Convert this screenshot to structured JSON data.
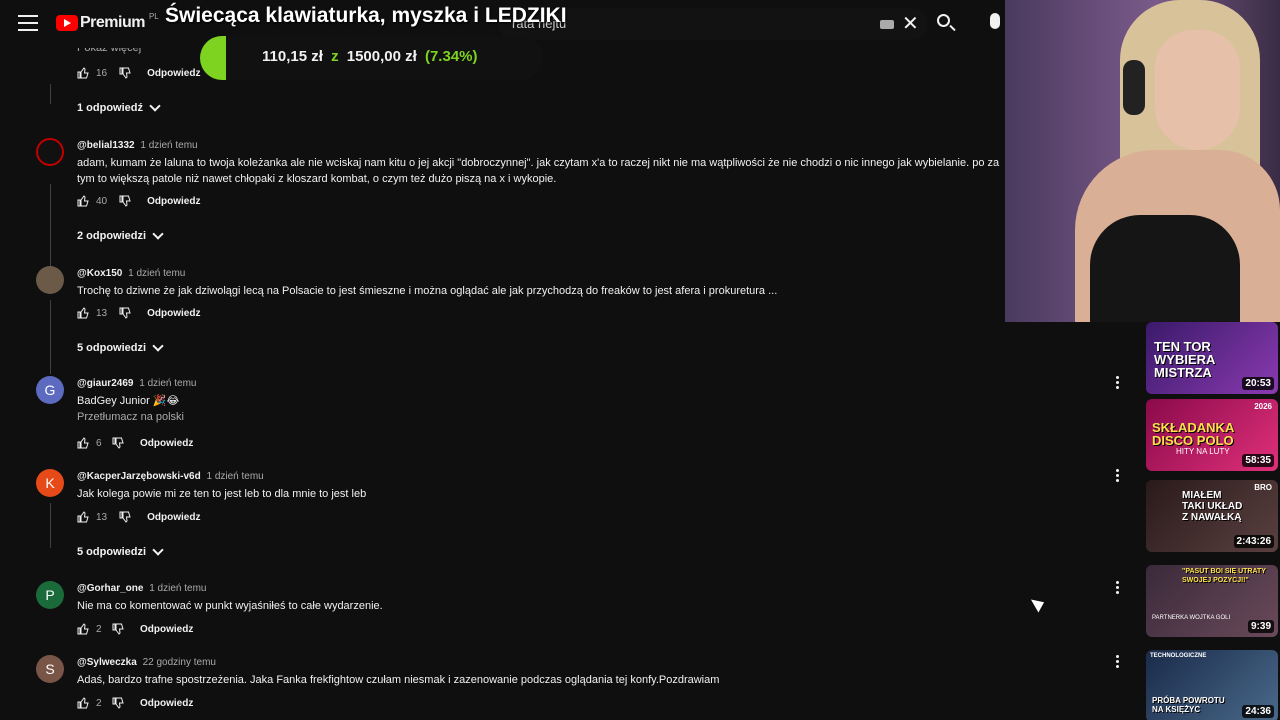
{
  "header": {
    "logo_text": "Premium",
    "logo_region": "PL",
    "search_text": "rata nejtu",
    "icons": [
      "menu-icon",
      "keyboard-icon",
      "close-icon",
      "search-icon",
      "mic-icon"
    ]
  },
  "stream": {
    "title": "Świecąca klawiaturka, myszka i LEDZIKI",
    "donation": {
      "current": "110,15 zł",
      "separator": "z",
      "goal": "1500,00 zł",
      "percent": "(7.34%)",
      "progress": 0.0734,
      "color": "#7ed321"
    }
  },
  "show_more": "Pokaż więcej",
  "comments": [
    {
      "id": "top",
      "likes": "16",
      "reply_label": "Odpowiedz",
      "replies_toggle": "1 odpowiedź"
    },
    {
      "id": "belial",
      "author": "@belial1332",
      "time": "1 dzień temu",
      "text": "adam, kumam że laluna to twoja koleżanka ale nie wciskaj nam kitu o jej akcji \"dobroczynnej\". jak czytam x'a to raczej nikt nie ma wątpliwości że nie chodzi o nic innego jak wybielanie. po za tym to większą patole niż nawet chłopaki z kloszard kombat, o czym też dużo piszą na x i wykopie.",
      "likes": "40",
      "reply_label": "Odpowiedz",
      "replies_toggle": "2 odpowiedzi",
      "avatar_color": "#c00000"
    },
    {
      "id": "kox",
      "author": "@Kox150",
      "time": "1 dzień temu",
      "text": "Trochę to dziwne że jak dziwolągi lecą na Polsacie to jest śmieszne i można oglądać ale jak przychodzą do freaków to jest afera i prokuretura ...",
      "likes": "13",
      "reply_label": "Odpowiedz",
      "replies_toggle": "5 odpowiedzi",
      "avatar_color": "#6b5a48"
    },
    {
      "id": "giaur",
      "author": "@giaur2469",
      "time": "1 dzień temu",
      "text": "BadGey Junior 🎉😂",
      "translate": "Przetłumacz na polski",
      "likes": "6",
      "reply_label": "Odpowiedz",
      "avatar_letter": "G",
      "avatar_color": "#5c6bc0"
    },
    {
      "id": "kacper",
      "author": "@KacperJarzębowski-v6d",
      "time": "1 dzień temu",
      "text": "Jak kolega powie mi ze ten to jest leb to dla mnie to jest leb",
      "likes": "13",
      "reply_label": "Odpowiedz",
      "replies_toggle": "5 odpowiedzi",
      "avatar_letter": "K",
      "avatar_color": "#e64a19"
    },
    {
      "id": "gorhar",
      "author": "@Gorhar_one",
      "time": "1 dzień temu",
      "text": "Nie ma co komentować w punkt wyjaśniłeś to całe wydarzenie.",
      "likes": "2",
      "reply_label": "Odpowiedz",
      "avatar_letter": "P",
      "avatar_color": "#1b6b3a"
    },
    {
      "id": "sylweczka",
      "author": "@Sylweczka",
      "time": "22 godziny temu",
      "text": "Adaś, bardzo trafne spostrzeżenia. Jaka Fanka frekfightow czułam niesmak i zazenowanie podczas oglądania tej konfy.Pozdrawiam",
      "likes": "2",
      "reply_label": "Odpowiedz",
      "avatar_letter": "S",
      "avatar_color": "#795548"
    }
  ],
  "side_videos": [
    {
      "label": "TEN TOR\nWYBIERA\nMISTRZA",
      "duration": "20:53",
      "bg": "#5a2a8a"
    },
    {
      "label": "SKŁADANKA\nDISCO POLO",
      "sub": "HITY NA LUTY",
      "top": "2026",
      "duration": "58:35",
      "bg": "#b0185a"
    },
    {
      "label": "MIAŁEM\nTAKI UKŁAD\nZ NAWAŁKĄ",
      "top": "BRO",
      "duration": "2:43:26",
      "bg": "#3a2a2a"
    },
    {
      "label": "\"PASUT BOI SIĘ UTRATY\nSWOJEJ POZYCJI!\"",
      "sub": "PARTNERKA WOJTKA GOLI",
      "duration": "9:39",
      "bg": "#4a3a4a"
    },
    {
      "label": "PRÓBA POWROTU\nNA KSIĘŻYC",
      "top": "TECHNOLOGICZNE",
      "duration": "24:36",
      "bg": "#2a3a5a"
    }
  ]
}
